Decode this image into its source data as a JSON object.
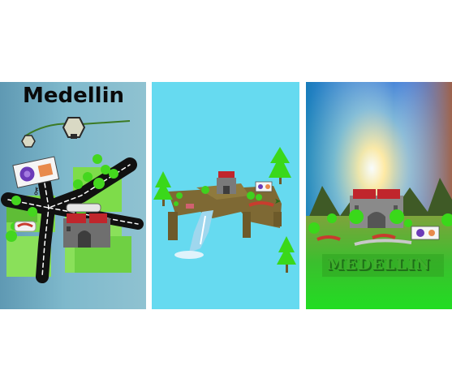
{
  "panels": [
    {
      "title": "Medellin"
    },
    {
      "title": ""
    },
    {
      "sign": "MEDELLIN"
    }
  ]
}
